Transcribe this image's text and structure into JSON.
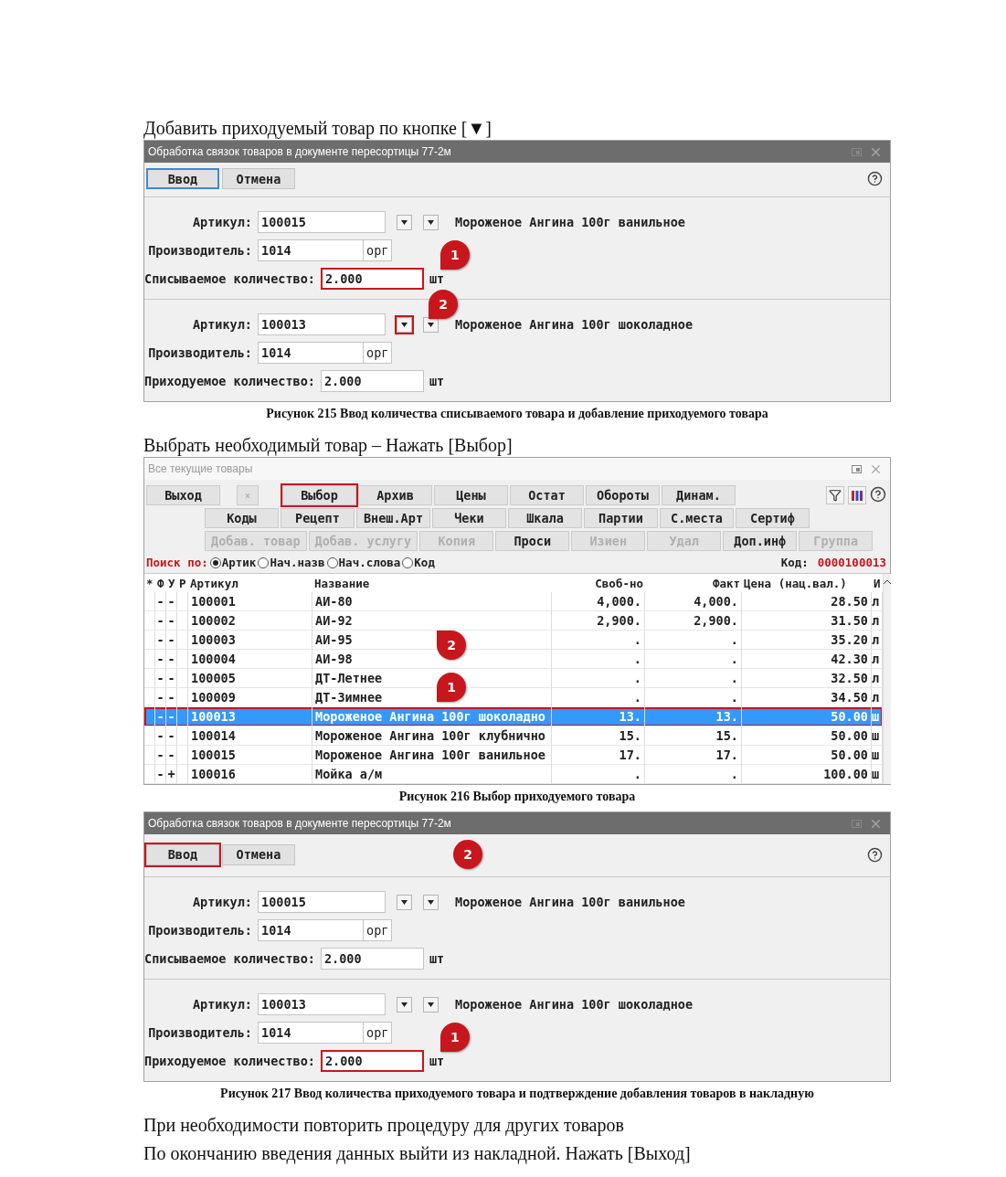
{
  "blocks": [
    {
      "kind": "paragraph",
      "text": "Добавить приходуемый товар по кнопке [▼]"
    },
    {
      "kind": "dialog",
      "title": "Обработка связок товаров в документе пересортицы 77-2м",
      "buttons": [
        {
          "label": "Ввод",
          "focused": true,
          "highlighted": false
        },
        {
          "label": "Отмена",
          "focused": false,
          "highlighted": false
        }
      ],
      "sections": [
        {
          "rows": [
            {
              "kind": "article",
              "label": "Артикул:",
              "value": "100015",
              "name": "Мороженое Ангина 100г ванильное",
              "dropdown_highlighted": false
            },
            {
              "kind": "maker",
              "label": "Производитель:",
              "value": "1014",
              "suffix": "орг"
            },
            {
              "kind": "qty",
              "label": "Списываемое количество:",
              "value": "2.000",
              "unit": "шт",
              "highlighted": true,
              "callout": "1"
            }
          ]
        },
        {
          "rows": [
            {
              "kind": "article",
              "label": "Артикул:",
              "value": "100013",
              "name": "Мороженое Ангина 100г шоколадное",
              "dropdown_highlighted": true,
              "callout": "2"
            },
            {
              "kind": "maker",
              "label": "Производитель:",
              "value": "1014",
              "suffix": "орг"
            },
            {
              "kind": "qty",
              "label": "Приходуемое количество:",
              "value": "2.000",
              "unit": "шт",
              "highlighted": false
            }
          ]
        }
      ]
    },
    {
      "kind": "caption",
      "text": "Рисунок 215 Ввод количества списываемого товара и добавление приходуемого товара"
    },
    {
      "kind": "paragraph",
      "text": "Выбрать необходимый товар – Нажать [Выбор]"
    },
    {
      "kind": "list_window",
      "title": "Все текущие товары",
      "toolbar": [
        [
          {
            "label": "Выход",
            "disabled": false,
            "highlighted": false
          },
          {
            "label": "×",
            "kind": "small",
            "disabled": true,
            "highlighted": false
          },
          {
            "label": "Выбор",
            "disabled": false,
            "highlighted": true
          },
          {
            "label": "Архив",
            "disabled": false,
            "highlighted": false
          },
          {
            "label": "Цены",
            "disabled": false,
            "highlighted": false
          },
          {
            "label": "Остат",
            "disabled": false,
            "highlighted": false
          },
          {
            "label": "Обороты",
            "disabled": false,
            "highlighted": false
          },
          {
            "label": "Динам.",
            "disabled": false,
            "highlighted": false
          }
        ],
        [
          {
            "label": "Коды",
            "disabled": false,
            "highlighted": false
          },
          {
            "label": "Рецепт",
            "disabled": false,
            "highlighted": false
          },
          {
            "label": "Внеш.Арт",
            "disabled": false,
            "highlighted": false
          },
          {
            "label": "Чеки",
            "disabled": false,
            "highlighted": false
          },
          {
            "label": "Шкала",
            "disabled": false,
            "highlighted": false
          },
          {
            "label": "Партии",
            "disabled": false,
            "highlighted": false
          },
          {
            "label": "С.места",
            "disabled": false,
            "highlighted": false
          },
          {
            "label": "Сертиф",
            "disabled": false,
            "highlighted": false
          }
        ],
        [
          {
            "label": "Добав. товар",
            "disabled": true,
            "highlighted": false
          },
          {
            "label": "Добав. услугу",
            "disabled": true,
            "highlighted": false
          },
          {
            "label": "Копия",
            "disabled": true,
            "highlighted": false
          },
          {
            "label": "Проси",
            "disabled": false,
            "highlighted": false
          },
          {
            "label": "Изиен",
            "disabled": true,
            "highlighted": false
          },
          {
            "label": "Удал",
            "disabled": true,
            "highlighted": false
          },
          {
            "label": "Доп.инф",
            "disabled": false,
            "highlighted": false
          },
          {
            "label": "Группа",
            "disabled": true,
            "highlighted": false
          }
        ]
      ],
      "search": {
        "label": "Поиск по:",
        "options": [
          {
            "label": "Артик",
            "selected": true
          },
          {
            "label": "Нач.назв",
            "selected": false
          },
          {
            "label": "Нач.слова",
            "selected": false
          },
          {
            "label": "Код",
            "selected": false
          }
        ],
        "code_label": "Код:",
        "code_value": "0000100013"
      },
      "table": {
        "columns": [
          "*",
          "Ф",
          "У",
          "Р",
          "Артикул",
          "Название",
          "Своб-но",
          "Факт",
          "Цена (нац.вал.)",
          "И"
        ],
        "callouts": [
          "2",
          "1"
        ],
        "rows": [
          {
            "f": "-",
            "u": "-",
            "article": "100001",
            "name": "АИ-80",
            "free": "4,000.",
            "fact": "4,000.",
            "price": "28.50",
            "unit": "л",
            "selected": false
          },
          {
            "f": "-",
            "u": "-",
            "article": "100002",
            "name": "АИ-92",
            "free": "2,900.",
            "fact": "2,900.",
            "price": "31.50",
            "unit": "л",
            "selected": false
          },
          {
            "f": "-",
            "u": "-",
            "article": "100003",
            "name": "АИ-95",
            "free": ".",
            "fact": ".",
            "price": "35.20",
            "unit": "л",
            "selected": false
          },
          {
            "f": "-",
            "u": "-",
            "article": "100004",
            "name": "АИ-98",
            "free": ".",
            "fact": ".",
            "price": "42.30",
            "unit": "л",
            "selected": false
          },
          {
            "f": "-",
            "u": "-",
            "article": "100005",
            "name": "ДТ-Летнее",
            "free": ".",
            "fact": ".",
            "price": "32.50",
            "unit": "л",
            "selected": false
          },
          {
            "f": "-",
            "u": "-",
            "article": "100009",
            "name": "ДТ-Зимнее",
            "free": ".",
            "fact": ".",
            "price": "34.50",
            "unit": "л",
            "selected": false
          },
          {
            "f": "-",
            "u": "-",
            "article": "100013",
            "name": "Мороженое Ангина 100г шоколадно",
            "free": "13.",
            "fact": "13.",
            "price": "50.00",
            "unit": "ш",
            "selected": true
          },
          {
            "f": "-",
            "u": "-",
            "article": "100014",
            "name": "Мороженое Ангина 100г клубнично",
            "free": "15.",
            "fact": "15.",
            "price": "50.00",
            "unit": "ш",
            "selected": false
          },
          {
            "f": "-",
            "u": "-",
            "article": "100015",
            "name": "Мороженое Ангина 100г ванильное",
            "free": "17.",
            "fact": "17.",
            "price": "50.00",
            "unit": "ш",
            "selected": false
          },
          {
            "f": "-",
            "u": "+",
            "article": "100016",
            "name": "Мойка а/м",
            "free": ".",
            "fact": ".",
            "price": "100.00",
            "unit": "ш",
            "selected": false
          }
        ]
      }
    },
    {
      "kind": "caption",
      "text": "Рисунок 216 Выбор приходуемого товара"
    },
    {
      "kind": "dialog",
      "title": "Обработка связок товаров в документе пересортицы 77-2м",
      "buttons": [
        {
          "label": "Ввод",
          "focused": false,
          "highlighted": true,
          "callout": "2"
        },
        {
          "label": "Отмена",
          "focused": false,
          "highlighted": false
        }
      ],
      "sections": [
        {
          "rows": [
            {
              "kind": "article",
              "label": "Артикул:",
              "value": "100015",
              "name": "Мороженое Ангина 100г ванильное",
              "dropdown_highlighted": false
            },
            {
              "kind": "maker",
              "label": "Производитель:",
              "value": "1014",
              "suffix": "орг"
            },
            {
              "kind": "qty",
              "label": "Списываемое количество:",
              "value": "2.000",
              "unit": "шт",
              "highlighted": false
            }
          ]
        },
        {
          "rows": [
            {
              "kind": "article",
              "label": "Артикул:",
              "value": "100013",
              "name": "Мороженое Ангина 100г шоколадное",
              "dropdown_highlighted": false
            },
            {
              "kind": "maker",
              "label": "Производитель:",
              "value": "1014",
              "suffix": "орг"
            },
            {
              "kind": "qty",
              "label": "Приходуемое количество:",
              "value": "2.000",
              "unit": "шт",
              "highlighted": true,
              "callout": "1"
            }
          ]
        }
      ]
    },
    {
      "kind": "caption",
      "text": "Рисунок 217 Ввод количества приходуемого товара и подтверждение добавления товаров в накладную"
    },
    {
      "kind": "paragraph",
      "text": "При необходимости повторить процедуру для других товаров"
    },
    {
      "kind": "paragraph",
      "text": "По окончанию введения данных выйти из накладной. Нажать [Выход]"
    }
  ]
}
